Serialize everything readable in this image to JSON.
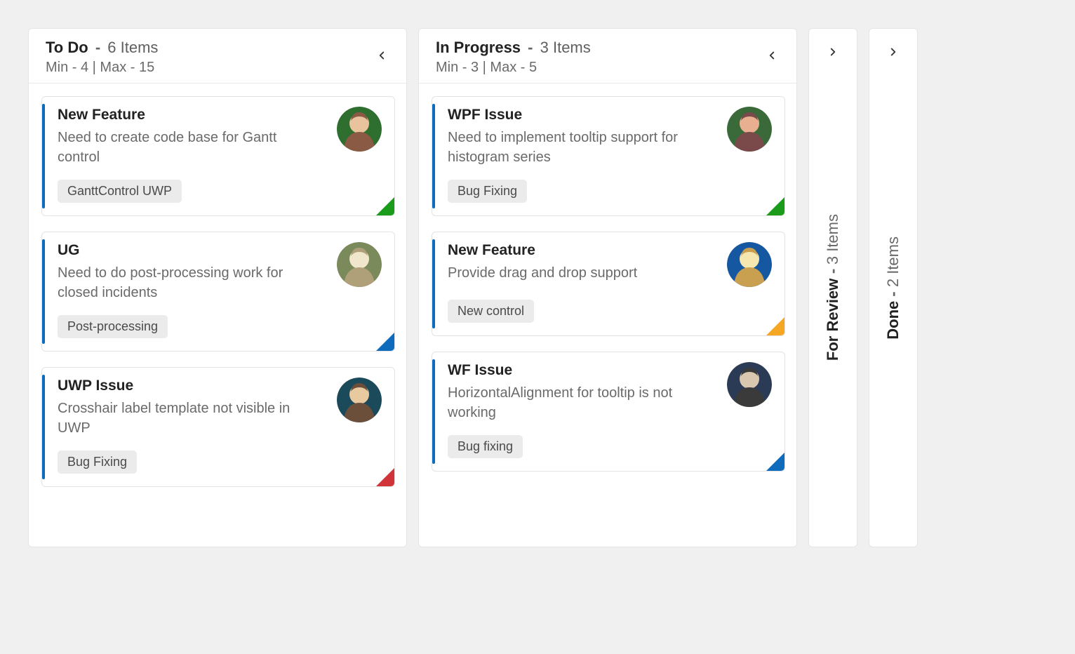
{
  "columns": {
    "todo": {
      "title": "To Do",
      "count_label": "6 Items",
      "limits": "Min - 4 | Max - 15",
      "cards": [
        {
          "title": "New Feature",
          "desc": "Need to create code base for Gantt control",
          "tag": "GanttControl UWP",
          "stripe": "#0f6cbd",
          "corner": "#1a9c1a",
          "avatar": "a1"
        },
        {
          "title": "UG",
          "desc": "Need to do post-processing work for closed incidents",
          "tag": "Post-processing",
          "stripe": "#0f6cbd",
          "corner": "#0f6cbd",
          "avatar": "a2"
        },
        {
          "title": "UWP Issue",
          "desc": "Crosshair label template not visible in UWP",
          "tag": "Bug Fixing",
          "stripe": "#0f6cbd",
          "corner": "#d13438",
          "avatar": "a3"
        }
      ]
    },
    "inprogress": {
      "title": "In Progress",
      "count_label": "3 Items",
      "limits": "Min - 3 | Max - 5",
      "cards": [
        {
          "title": "WPF Issue",
          "desc": "Need to implement tooltip support for histogram series",
          "tag": "Bug Fixing",
          "stripe": "#0f6cbd",
          "corner": "#1a9c1a",
          "avatar": "a4"
        },
        {
          "title": "New Feature",
          "desc": "Provide drag and drop support",
          "tag": "New control",
          "stripe": "#0f6cbd",
          "corner": "#f5a623",
          "avatar": "a5"
        },
        {
          "title": "WF Issue",
          "desc": "HorizontalAlignment for tooltip is not working",
          "tag": "Bug fixing",
          "stripe": "#0f6cbd",
          "corner": "#0f6cbd",
          "avatar": "a6"
        }
      ]
    },
    "forreview": {
      "title": "For Review",
      "count_label": "3 Items"
    },
    "done": {
      "title": "Done",
      "count_label": "2 Items"
    }
  },
  "avatars": {
    "a1": {
      "bg1": "#8a5a44",
      "bg2": "#e8c39e",
      "frame": "#2e6e2e"
    },
    "a2": {
      "bg1": "#b0a07a",
      "bg2": "#f0e6cc",
      "frame": "#7a8a5a"
    },
    "a3": {
      "bg1": "#6b4f3a",
      "bg2": "#e8c9a0",
      "frame": "#1b4a5a"
    },
    "a4": {
      "bg1": "#7a4a4a",
      "bg2": "#e8b090",
      "frame": "#3a6a3a"
    },
    "a5": {
      "bg1": "#c9a050",
      "bg2": "#f6e6b0",
      "frame": "#1557a0"
    },
    "a6": {
      "bg1": "#3a3a3a",
      "bg2": "#d9c7b0",
      "frame": "#2b3a55"
    }
  }
}
